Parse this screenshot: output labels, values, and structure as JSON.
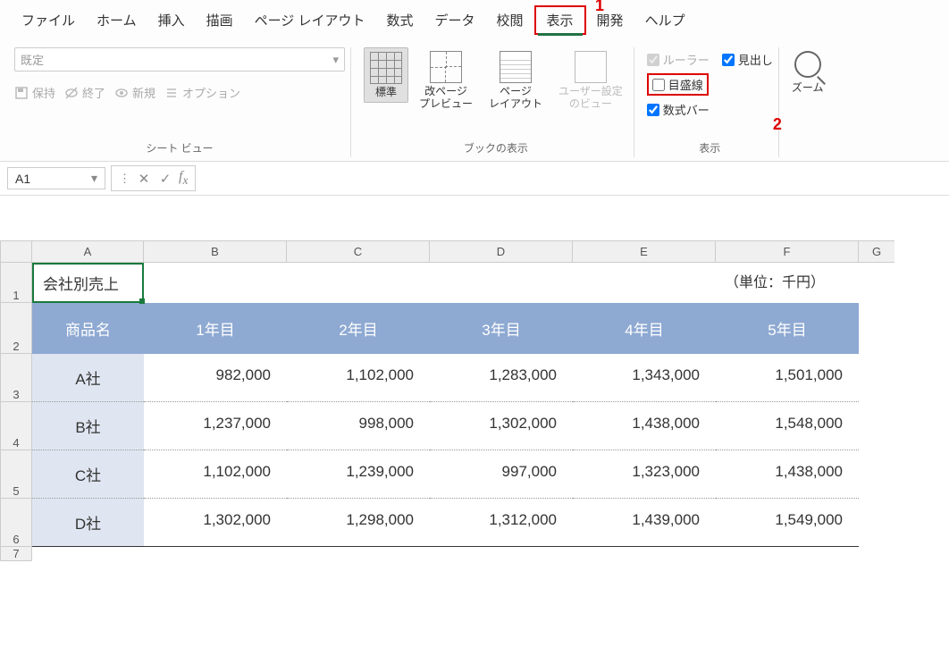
{
  "menubar": {
    "items": [
      "ファイル",
      "ホーム",
      "挿入",
      "描画",
      "ページ レイアウト",
      "数式",
      "データ",
      "校閲",
      "表示",
      "開発",
      "ヘルプ"
    ],
    "active_index": 8
  },
  "ribbon": {
    "sheet_view": {
      "dropdown_value": "既定",
      "keep": "保持",
      "exit": "終了",
      "new": "新規",
      "options": "オプション",
      "group_label": "シート ビュー"
    },
    "book_view": {
      "normal": "標準",
      "page_break": "改ページ\nプレビュー",
      "page_layout": "ページ\nレイアウト",
      "custom": "ユーザー設定\nのビュー",
      "group_label": "ブックの表示"
    },
    "show": {
      "ruler": "ルーラー",
      "headings": "見出し",
      "gridlines": "目盛線",
      "formula_bar": "数式バー",
      "group_label": "表示",
      "ruler_checked": true,
      "headings_checked": true,
      "gridlines_checked": false,
      "formula_bar_checked": true
    },
    "zoom": {
      "label": "ズーム"
    }
  },
  "annotations": {
    "one": "1",
    "two": "2"
  },
  "formula_bar": {
    "name_box": "A1"
  },
  "sheet": {
    "columns": [
      "A",
      "B",
      "C",
      "D",
      "E",
      "F",
      "G"
    ],
    "row_numbers": [
      "1",
      "2",
      "3",
      "4",
      "5",
      "6",
      "7"
    ],
    "title": "会社別売上",
    "unit_note": "（単位：千円）",
    "headers": [
      "商品名",
      "1年目",
      "2年目",
      "3年目",
      "4年目",
      "5年目"
    ],
    "rows": [
      {
        "label": "A社",
        "values": [
          "982,000",
          "1,102,000",
          "1,283,000",
          "1,343,000",
          "1,501,000"
        ]
      },
      {
        "label": "B社",
        "values": [
          "1,237,000",
          "998,000",
          "1,302,000",
          "1,438,000",
          "1,548,000"
        ]
      },
      {
        "label": "C社",
        "values": [
          "1,102,000",
          "1,239,000",
          "997,000",
          "1,323,000",
          "1,438,000"
        ]
      },
      {
        "label": "D社",
        "values": [
          "1,302,000",
          "1,298,000",
          "1,312,000",
          "1,439,000",
          "1,549,000"
        ]
      }
    ]
  }
}
